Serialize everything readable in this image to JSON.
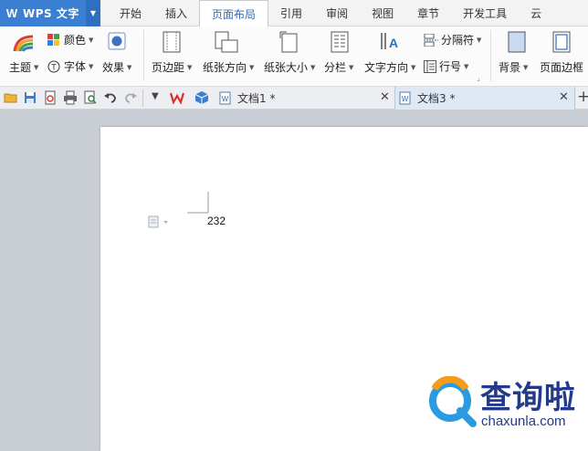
{
  "app": {
    "name": "WPS 文字"
  },
  "menu": {
    "tabs": [
      "开始",
      "插入",
      "页面布局",
      "引用",
      "审阅",
      "视图",
      "章节",
      "开发工具",
      "云"
    ],
    "active_index": 2
  },
  "ribbon": {
    "theme": "主题",
    "color": "颜色",
    "font": "字体",
    "effect": "效果",
    "margins": "页边距",
    "orientation": "纸张方向",
    "size": "纸张大小",
    "columns": "分栏",
    "text_direction": "文字方向",
    "breaks": "分隔符",
    "line_numbers": "行号",
    "background": "背景",
    "page_border": "页面边框"
  },
  "doc_tabs": [
    {
      "label": "文档1 *",
      "active": false
    },
    {
      "label": "文档3 *",
      "active": true
    }
  ],
  "document": {
    "text": "232"
  },
  "watermark": {
    "brand": "查询啦",
    "url": "chaxunla.com"
  },
  "colors": {
    "accent": "#3a7fd1",
    "watermark": "#233a8c",
    "workspace": "#c9cdd4"
  }
}
